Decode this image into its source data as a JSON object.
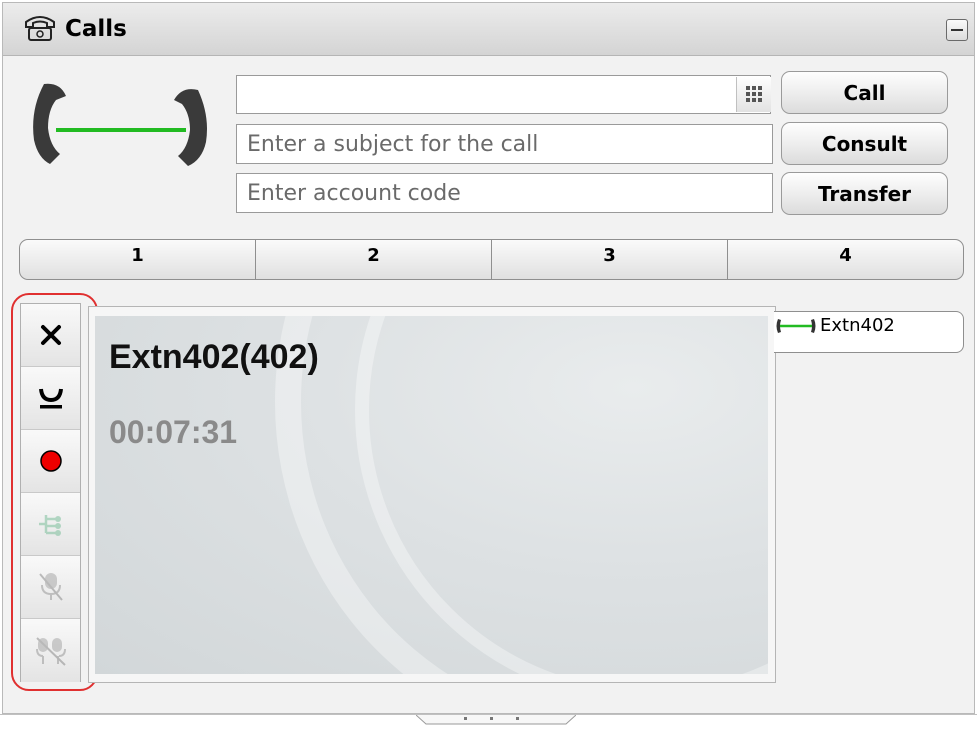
{
  "window": {
    "title": "Calls",
    "title_icon": "phone-icon",
    "minimize_icon": "minimize-icon"
  },
  "dialer": {
    "number": {
      "value": "",
      "placeholder": ""
    },
    "subject": {
      "value": "",
      "placeholder": "Enter a subject for the call"
    },
    "account_code": {
      "value": "",
      "placeholder": "Enter account code"
    },
    "keypad_icon": "keypad-icon",
    "buttons": {
      "call": "Call",
      "consult": "Consult",
      "transfer": "Transfer"
    }
  },
  "call_tabs": [
    "1",
    "2",
    "3",
    "4"
  ],
  "call_controls": [
    {
      "name": "drop-call",
      "icon": "close-icon"
    },
    {
      "name": "hold-call",
      "icon": "hold-icon"
    },
    {
      "name": "record-call",
      "icon": "record-icon"
    },
    {
      "name": "conference",
      "icon": "conference-icon",
      "enabled": false
    },
    {
      "name": "mute",
      "icon": "mute-icon",
      "enabled": false
    },
    {
      "name": "mute-all",
      "icon": "mute-all-icon",
      "enabled": false
    }
  ],
  "active_call": {
    "caller": "Extn402(402)",
    "duration": "00:07:31",
    "connected_color": "#22bb22"
  },
  "call_list": [
    {
      "label": "Extn402",
      "icon": "connected-call-icon"
    }
  ],
  "colors": {
    "highlight": "#e03030",
    "record": "#ee0000"
  }
}
